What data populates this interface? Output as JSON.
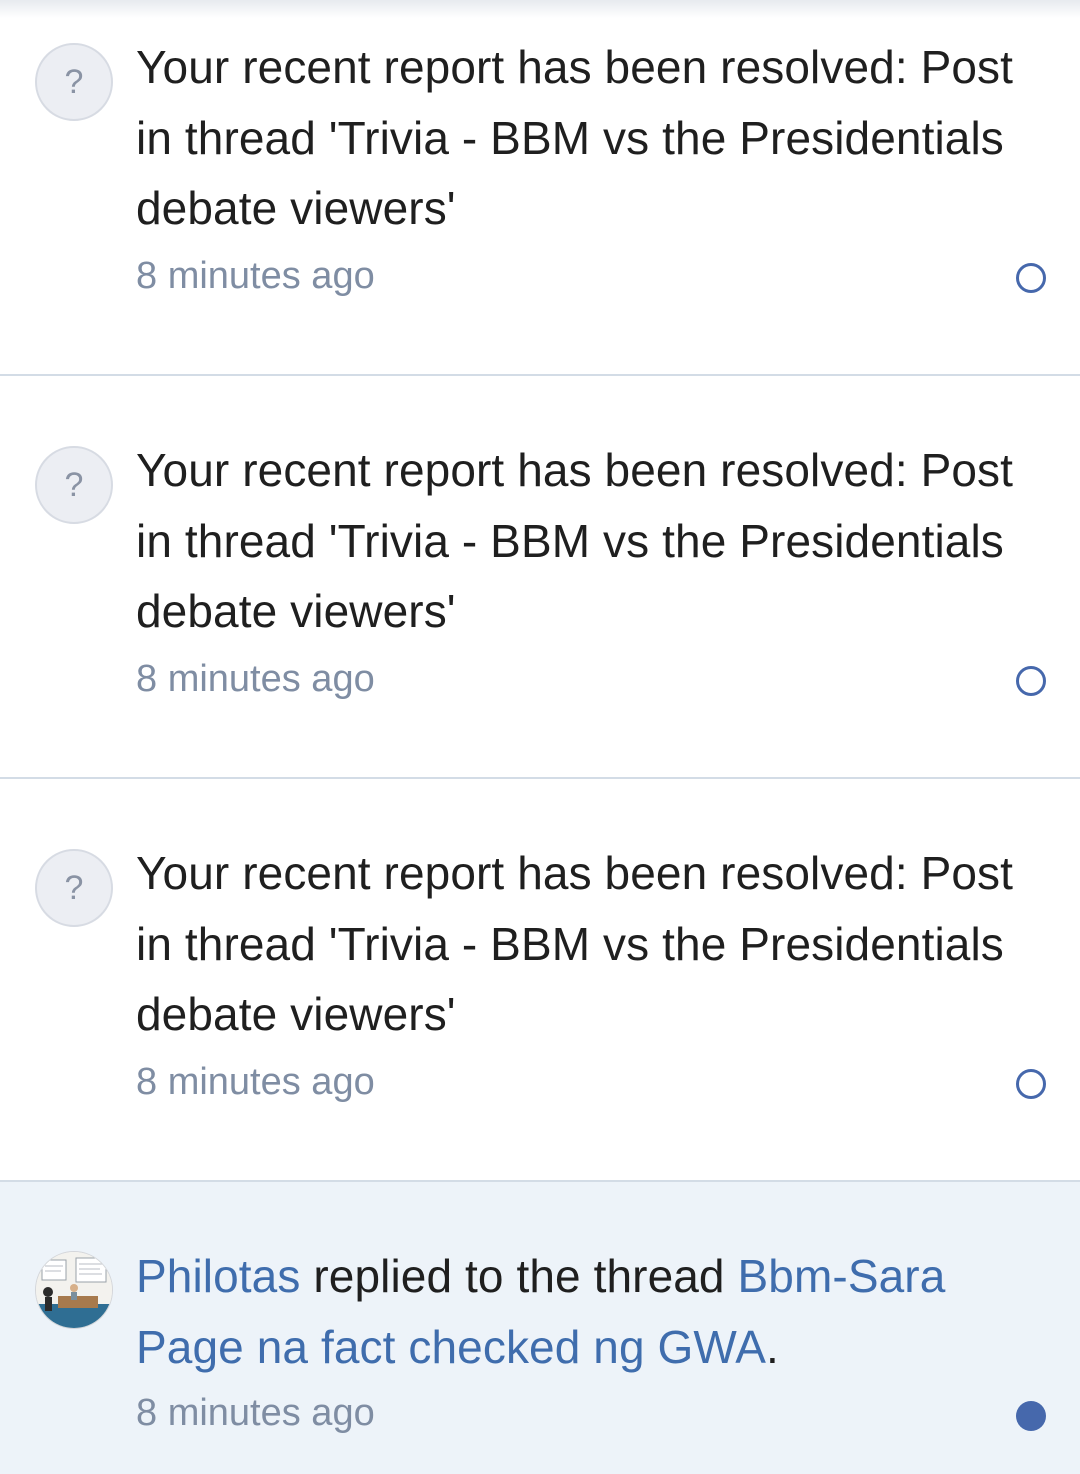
{
  "notifications": [
    {
      "type": "report",
      "avatar_glyph": "?",
      "message": "Your recent report has been resolved: Post in thread 'Trivia - BBM vs the Presidentials debate viewers'",
      "time": "8 minutes ago",
      "read_state": "read"
    },
    {
      "type": "report",
      "avatar_glyph": "?",
      "message": "Your recent report has been resolved: Post in thread 'Trivia - BBM vs the Presidentials debate viewers'",
      "time": "8 minutes ago",
      "read_state": "read"
    },
    {
      "type": "report",
      "avatar_glyph": "?",
      "message": "Your recent report has been resolved: Post in thread 'Trivia - BBM vs the Presidentials debate viewers'",
      "time": "8 minutes ago",
      "read_state": "read"
    },
    {
      "type": "reply",
      "user": "Philotas",
      "action": "replied to the thread",
      "thread_title": "Bbm-Sara Page na fact checked ng GWA",
      "punctuation": ".",
      "time": "8 minutes ago",
      "read_state": "unread"
    }
  ],
  "colors": {
    "link": "#3f6dad",
    "timestamp": "#7f8da3",
    "unread_background": "#edf3f9",
    "read_marker": "#4668ac",
    "divider": "#d3dce6"
  },
  "icons": {
    "report_avatar": "question-mark-avatar-icon",
    "read_marker": "hollow-circle-icon",
    "unread_marker": "filled-circle-icon"
  }
}
